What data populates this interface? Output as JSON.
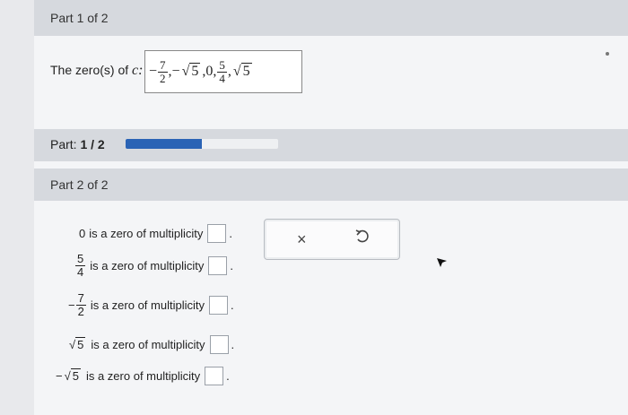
{
  "part1": {
    "title": "Part 1 of 2"
  },
  "question": {
    "label_prefix": "The zero(s) of",
    "label_var": "c:",
    "answer": {
      "frac1_num": "7",
      "frac1_den": "2",
      "neg_sign": "−",
      "sep1": ",",
      "sep2": ",",
      "sep3": ",",
      "sep4": ",",
      "rad1_arg": "5",
      "zero": "0",
      "frac2_num": "5",
      "frac2_den": "4",
      "rad2_arg": "5"
    }
  },
  "progress": {
    "label": "Part:",
    "value_text": "1 / 2",
    "fraction": 0.5
  },
  "part2": {
    "title": "Part 2 of 2"
  },
  "rows": [
    {
      "prefix": "0",
      "text": "is a zero of multiplicity"
    },
    {
      "frac_num": "5",
      "frac_den": "4",
      "text": "is a zero of multiplicity"
    },
    {
      "neg": "−",
      "frac_num": "7",
      "frac_den": "2",
      "text": "is a zero of multiplicity"
    },
    {
      "rad": "5",
      "text": "is a zero of multiplicity"
    },
    {
      "neg": "−",
      "rad": "5",
      "text": "is a zero of multiplicity"
    }
  ],
  "period": ".",
  "tools": {
    "clear": "×",
    "clear_icon": "x-icon",
    "undo_icon": "undo-icon"
  }
}
